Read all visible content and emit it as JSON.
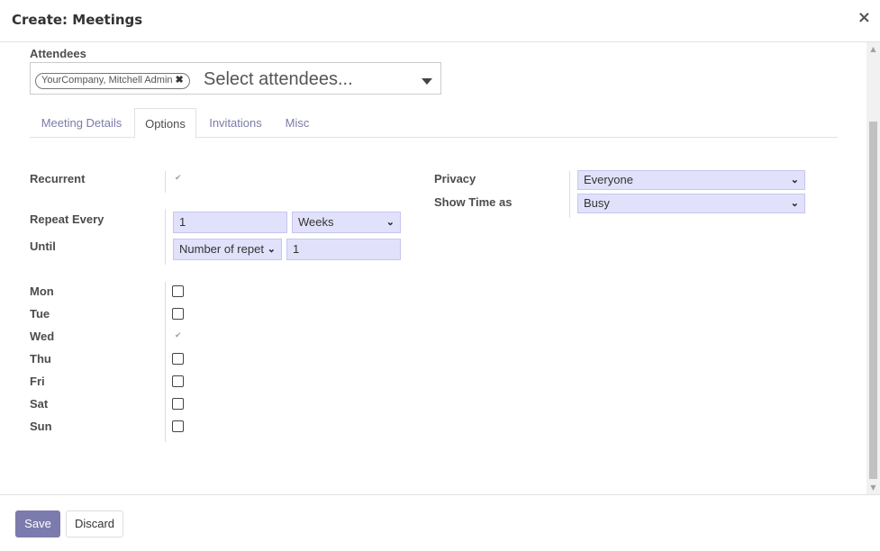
{
  "header": {
    "title": "Create: Meetings",
    "close_icon": "×"
  },
  "attendees": {
    "label": "Attendees",
    "tags": [
      {
        "name": "YourCompany, Mitchell Admin"
      }
    ],
    "tag_remove_icon": "✖",
    "placeholder": "Select attendees..."
  },
  "tabs": [
    {
      "label": "Meeting Details",
      "active": false
    },
    {
      "label": "Options",
      "active": true
    },
    {
      "label": "Invitations",
      "active": false
    },
    {
      "label": "Misc",
      "active": false
    }
  ],
  "options": {
    "recurrent": {
      "label": "Recurrent",
      "checked": true
    },
    "repeat_every": {
      "label": "Repeat Every",
      "interval": "1",
      "unit": "Weeks"
    },
    "until": {
      "label": "Until",
      "mode": "Number of repet",
      "count": "1"
    },
    "weekdays": [
      {
        "label": "Mon",
        "checked": false
      },
      {
        "label": "Tue",
        "checked": false
      },
      {
        "label": "Wed",
        "checked": true
      },
      {
        "label": "Thu",
        "checked": false
      },
      {
        "label": "Fri",
        "checked": false
      },
      {
        "label": "Sat",
        "checked": false
      },
      {
        "label": "Sun",
        "checked": false
      }
    ],
    "privacy": {
      "label": "Privacy",
      "value": "Everyone"
    },
    "show_time_as": {
      "label": "Show Time as",
      "value": "Busy"
    }
  },
  "footer": {
    "save_label": "Save",
    "discard_label": "Discard"
  },
  "colors": {
    "primary": "#7c7bad",
    "field_bg": "#e1e1fb",
    "tab_inactive": "#7c7ba8"
  }
}
